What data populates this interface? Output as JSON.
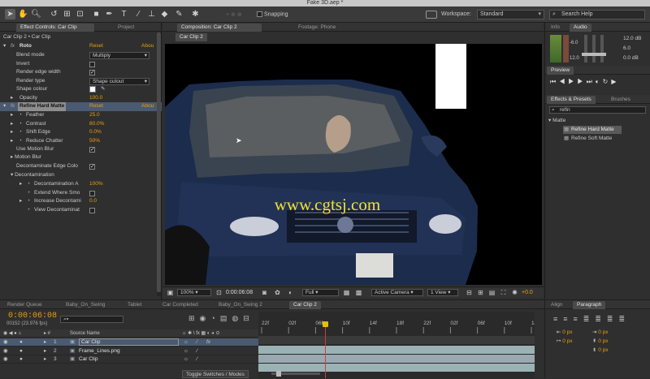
{
  "window": {
    "title": "Fake 3D.aep *"
  },
  "toolbar": {
    "snapping_label": "Snapping",
    "workspace_label": "Workspace:",
    "workspace_value": "Standard",
    "search_placeholder": "Search Help"
  },
  "left_panel": {
    "tabs": [
      "Effect Controls: Car Clip",
      "Project"
    ],
    "breadcrumb": "Car Clip 2 • Car Clip",
    "roto": {
      "name": "Roto",
      "reset": "Reset",
      "about": "Abou",
      "props": [
        {
          "label": "Blend mode",
          "value": "Multiply",
          "type": "select"
        },
        {
          "label": "Invert",
          "value": "",
          "type": "check",
          "checked": false
        },
        {
          "label": "Render edge width",
          "value": "",
          "type": "check",
          "checked": true
        },
        {
          "label": "Render type",
          "value": "Shape cutout",
          "type": "select"
        },
        {
          "label": "Shape colour",
          "value": "",
          "type": "swatch",
          "color": "#ffffff"
        },
        {
          "label": "Opacity",
          "value": "100.0",
          "type": "value"
        }
      ]
    },
    "refine": {
      "name": "Refine Hard Matte",
      "reset": "Reset",
      "about": "Abou",
      "props": [
        {
          "label": "Feather",
          "value": "25.0"
        },
        {
          "label": "Contrast",
          "value": "80.0%"
        },
        {
          "label": "Shift Edge",
          "value": "0.0%"
        },
        {
          "label": "Reduce Chatter",
          "value": "50%"
        }
      ],
      "use_motion_blur": "Use Motion Blur",
      "motion_blur": "Motion Blur",
      "decontaminate_edge": "Decontaminate Edge Colo",
      "decontamination": "Decontamination",
      "decon_props": [
        {
          "label": "Decontamination A",
          "value": "100%"
        },
        {
          "label": "Extend Where Smo",
          "value": ""
        },
        {
          "label": "Increase Decontami",
          "value": "0.0"
        },
        {
          "label": "View Decontaminat",
          "value": ""
        }
      ]
    }
  },
  "comp_panel": {
    "tabs": [
      "Composition: Car Clip 2",
      "Footage: Phone"
    ],
    "sub_tab": "Car Clip 2",
    "watermark": "www.cgtsj.com",
    "footer": {
      "zoom": "100%",
      "timecode": "0:00:06:08",
      "resolution": "Full",
      "camera": "Active Camera",
      "views": "1 View",
      "exposure": "+0.0"
    }
  },
  "right_panel": {
    "info_tabs": [
      "Info",
      "Audio"
    ],
    "audio_levels": [
      "12.0 dB",
      "6.0",
      "0.0 dB",
      "-6.0",
      "12.0"
    ],
    "preview_tab": "Preview",
    "effects_tabs": [
      "Effects & Presets",
      "Brushes"
    ],
    "effects_search": "refin",
    "effects_group": "Matte",
    "effects_items": [
      "Refine Hard Matte",
      "Refine Soft Matte"
    ],
    "bottom_tabs": [
      "Align",
      "Paragraph"
    ],
    "para_values": [
      "0 px",
      "0 px",
      "0 px",
      "0 px",
      "0 px"
    ]
  },
  "timeline": {
    "tabs": [
      "Render Queue",
      "Baby_On_Swing",
      "Tablet",
      "Car Completed",
      "Baby_On_Swing 2",
      "Car Clip 2"
    ],
    "timecode": "0:00:06:08",
    "frame_info": "00152 (23.976 fps)",
    "col_header": "Source Name",
    "ruler_ticks": [
      "22f",
      "02f",
      "06f",
      "10f",
      "14f",
      "18f",
      "22f",
      "02f",
      "06f",
      "10f",
      "14f"
    ],
    "layers": [
      {
        "num": "1",
        "name": "Car Clip",
        "selected": true
      },
      {
        "num": "2",
        "name": "Frame_Lines.png",
        "selected": false
      },
      {
        "num": "3",
        "name": "Car Clip",
        "selected": false
      }
    ],
    "toggle_label": "Toggle Switches / Modes",
    "playhead_fraction": 0.24
  },
  "colors": {
    "accent": "#e5a00d",
    "panel": "#2f2f2f",
    "selection": "#4a5a70"
  }
}
